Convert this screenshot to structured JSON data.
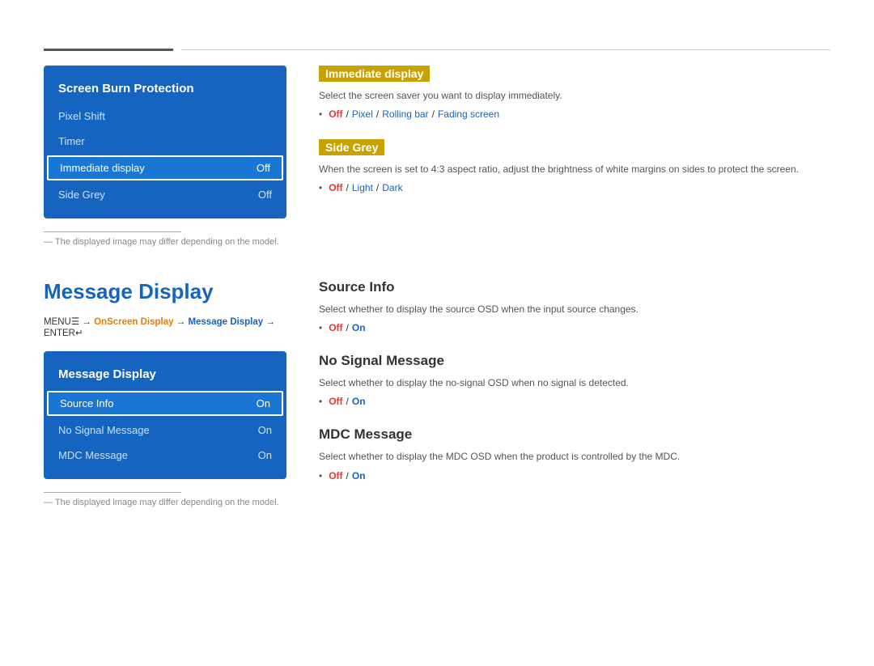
{
  "topDivider": true,
  "section1": {
    "menu": {
      "title": "Screen Burn Protection",
      "items": [
        {
          "label": "Pixel Shift",
          "value": "",
          "selected": false
        },
        {
          "label": "Timer",
          "value": "",
          "selected": false
        },
        {
          "label": "Immediate display",
          "value": "Off",
          "selected": true
        },
        {
          "label": "Side Grey",
          "value": "Off",
          "selected": false
        }
      ]
    },
    "note": "The displayed image may differ depending on the model.",
    "rightSections": [
      {
        "type": "highlight",
        "title": "Immediate display",
        "desc": "Select the screen saver you want to display immediately.",
        "options": [
          "Off",
          "/",
          "Pixel",
          "/",
          "Rolling bar",
          "/",
          "Fading screen"
        ],
        "optTypes": [
          "off",
          "sep",
          "on",
          "sep",
          "on",
          "sep",
          "on"
        ]
      },
      {
        "type": "highlight",
        "title": "Side Grey",
        "desc": "When the screen is set to 4:3 aspect ratio, adjust the brightness of white margins on sides to protect the screen.",
        "options": [
          "Off",
          "/",
          "Light",
          "/",
          "Dark"
        ],
        "optTypes": [
          "off",
          "sep",
          "on",
          "sep",
          "on"
        ]
      }
    ]
  },
  "section2": {
    "pageTitle": "Message Display",
    "breadcrumb": {
      "parts": [
        {
          "text": "MENU",
          "type": "plain"
        },
        {
          "text": "≡",
          "type": "plain"
        },
        {
          "text": " → ",
          "type": "plain"
        },
        {
          "text": "OnScreen Display",
          "type": "orange"
        },
        {
          "text": " → ",
          "type": "plain"
        },
        {
          "text": "Message Display",
          "type": "blue"
        },
        {
          "text": " → ENTER",
          "type": "plain"
        },
        {
          "text": "↵",
          "type": "plain"
        }
      ]
    },
    "menu": {
      "title": "Message Display",
      "items": [
        {
          "label": "Source Info",
          "value": "On",
          "selected": true
        },
        {
          "label": "No Signal Message",
          "value": "On",
          "selected": false
        },
        {
          "label": "MDC Message",
          "value": "On",
          "selected": false
        }
      ]
    },
    "note": "The displayed image may differ depending on the model.",
    "rightSections": [
      {
        "type": "plain",
        "title": "Source Info",
        "desc": "Select whether to display the source OSD when the input source changes.",
        "options": [
          "Off",
          "/",
          "On"
        ],
        "optTypes": [
          "off",
          "sep",
          "on"
        ]
      },
      {
        "type": "plain",
        "title": "No Signal Message",
        "desc": "Select whether to display the no-signal OSD when no signal is detected.",
        "options": [
          "Off",
          "/",
          "On"
        ],
        "optTypes": [
          "off",
          "sep",
          "on"
        ]
      },
      {
        "type": "plain",
        "title": "MDC Message",
        "desc": "Select whether to display the MDC OSD when the product is controlled by the MDC.",
        "options": [
          "Off",
          "/",
          "On"
        ],
        "optTypes": [
          "off",
          "sep",
          "on"
        ]
      }
    ]
  }
}
